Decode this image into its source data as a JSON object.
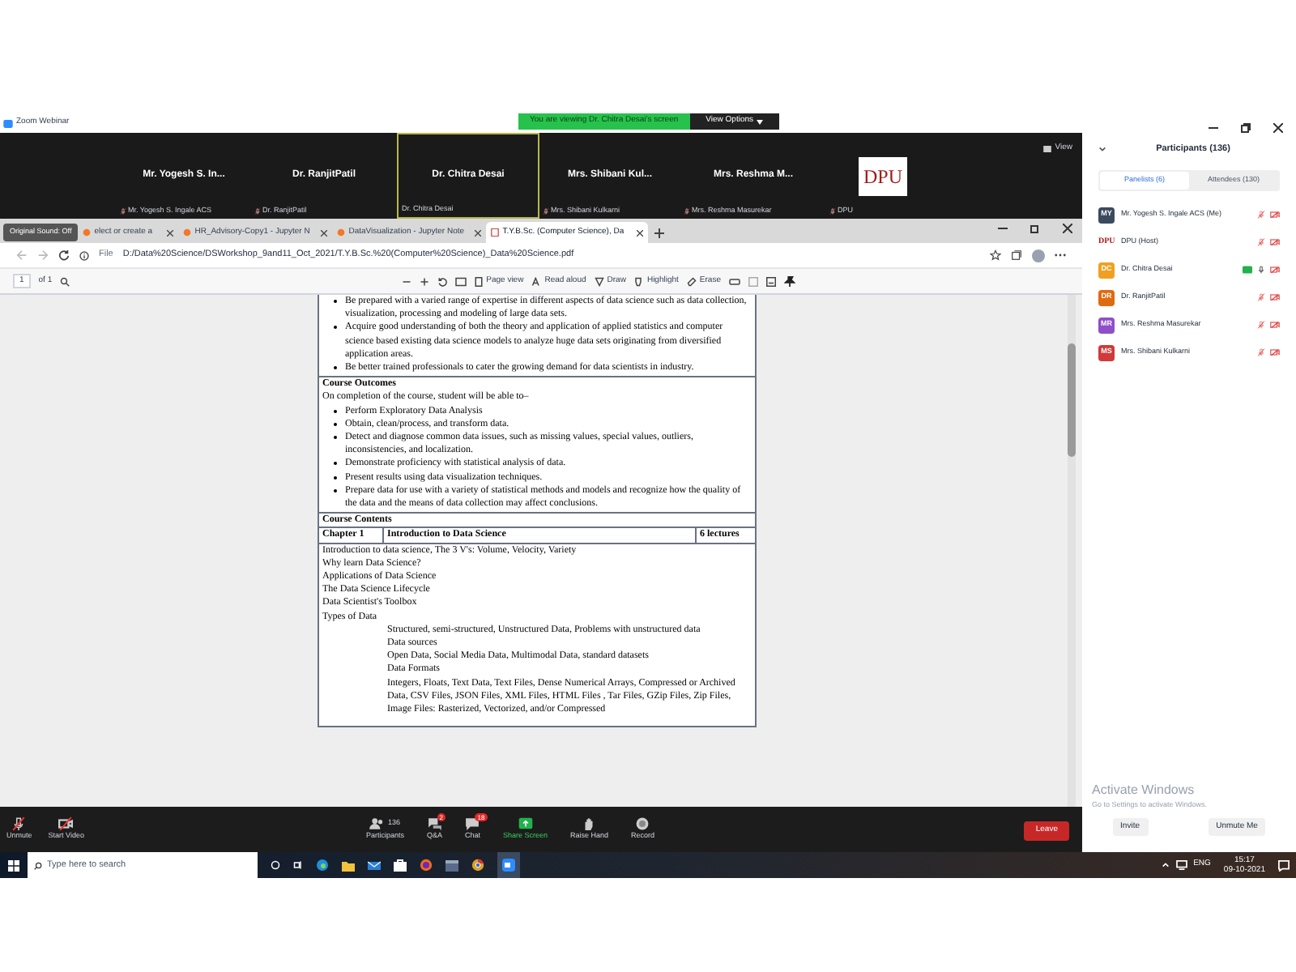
{
  "zoom_window": {
    "title": "Zoom Webinar",
    "viewing_banner": "You are viewing Dr. Chitra Desai's screen",
    "view_options": "View Options",
    "view_button": "View"
  },
  "video_tiles": [
    {
      "kind": "name",
      "display_name": "Mr. Yogesh S. In...",
      "label": "Mr. Yogesh S. Ingale ACS",
      "muted": true,
      "selected": false
    },
    {
      "kind": "name",
      "display_name": "Dr. RanjitPatil",
      "label": "Dr. RanjitPatil",
      "muted": true,
      "selected": false
    },
    {
      "kind": "name",
      "display_name": "Dr. Chitra Desai",
      "label": "Dr. Chitra Desai",
      "muted": false,
      "selected": true
    },
    {
      "kind": "name",
      "display_name": "Mrs. Shibani Kul...",
      "label": "Mrs. Shibani Kulkarni",
      "muted": true,
      "selected": false
    },
    {
      "kind": "name",
      "display_name": "Mrs. Reshma M...",
      "label": "Mrs. Reshma Masurekar",
      "muted": true,
      "selected": false
    },
    {
      "kind": "logo",
      "display_name": "DPU",
      "label": "DPU",
      "muted": true,
      "selected": false
    }
  ],
  "browser": {
    "original_sound_chip": "Original Sound: Off",
    "tabs": [
      {
        "title": "elect or create a",
        "selected": false,
        "kind": "jupyter"
      },
      {
        "title": "HR_Advisory-Copy1 - Jupyter N",
        "selected": false,
        "kind": "jupyter"
      },
      {
        "title": "DataVisualization - Jupyter Note",
        "selected": false,
        "kind": "jupyter"
      },
      {
        "title": "T.Y.B.Sc. (Computer Science), Da",
        "selected": true,
        "kind": "pdf"
      }
    ],
    "address_scheme": "File",
    "address": "D:/Data%20Science/DSWorkshop_9and11_Oct_2021/T.Y.B.Sc.%20(Computer%20Science)_Data%20Science.pdf"
  },
  "pdf_toolbar": {
    "page": "1",
    "page_count": "of 1",
    "page_view": "Page view",
    "read_aloud": "Read aloud",
    "draw": "Draw",
    "highlight": "Highlight",
    "erase": "Erase"
  },
  "document": {
    "objectives": [
      "Be prepared with a varied range of expertise in different aspects of data science such as data collection, visualization, processing and modeling of large data sets.",
      "Acquire good understanding of both the theory and application of applied statistics and computer science based existing data science models to analyze huge data sets originating from diversified application areas.",
      "Be better trained professionals to cater the growing demand for data scientists in industry."
    ],
    "outcomes_heading": "Course Outcomes",
    "outcomes_intro": "On completion of the course, student will be able to–",
    "outcomes": [
      "Perform Exploratory Data Analysis",
      "Obtain, clean/process, and transform data.",
      "Detect and diagnose common data issues, such as missing values, special values, outliers, inconsistencies, and localization.",
      "Demonstrate proficiency with statistical analysis of data.",
      "Present results using data visualization techniques.",
      "Prepare data for use with a variety of statistical methods and models and recognize how the quality of the data and the means of data collection may affect conclusions."
    ],
    "contents_heading": "Course Contents",
    "chapter": "Chapter 1",
    "chapter_title": "Introduction to Data Science",
    "lectures": "6 lectures",
    "topics": [
      {
        "text": "Introduction to data science, The 3 V's: Volume, Velocity, Variety"
      },
      {
        "text": "Why learn Data Science?"
      },
      {
        "text": "Applications of Data Science"
      },
      {
        "text": "The Data Science Lifecycle"
      },
      {
        "text": "Data Scientist's Toolbox"
      },
      {
        "text": "Types of Data",
        "children": [
          {
            "text": "Structured, semi-structured, Unstructured Data, Problems with unstructured data"
          },
          {
            "text": "Data sources"
          },
          {
            "text": "Open Data, Social Media Data, Multimodal Data, standard datasets"
          },
          {
            "text": "Data Formats"
          },
          {
            "text": "Integers, Floats, Text Data, Text Files, Dense Numerical Arrays, Compressed or Archived Data, CSV Files, JSON Files, XML Files, HTML Files , Tar Files, GZip Files, Zip Files, Image Files: Rasterized, Vectorized, and/or Compressed"
          }
        ]
      }
    ]
  },
  "zoom_toolbar": {
    "buttons": [
      {
        "kind": "unmute",
        "label": "Unmute"
      },
      {
        "kind": "video",
        "label": "Start Video"
      },
      {
        "kind": "participants",
        "label": "Participants",
        "count": "136"
      },
      {
        "kind": "qa",
        "label": "Q&A",
        "badge": "2"
      },
      {
        "kind": "chat",
        "label": "Chat",
        "badge": "18"
      },
      {
        "kind": "share",
        "label": "Share Screen"
      },
      {
        "kind": "hand",
        "label": "Raise Hand"
      },
      {
        "kind": "record",
        "label": "Record"
      }
    ],
    "leave": "Leave"
  },
  "participants_panel": {
    "title": "Participants (136)",
    "tabs": [
      {
        "label": "Panelists (6)",
        "selected": true
      },
      {
        "label": "Attendees (130)",
        "selected": false
      }
    ],
    "people": [
      {
        "kind": "avatar",
        "initials": "MY",
        "color": "#3b4a5e",
        "name": "Mr. Yogesh S. Ingale ACS (Me)",
        "muted": true
      },
      {
        "kind": "logo",
        "initials": "DPU",
        "color": "#b01818",
        "name": "DPU (Host)",
        "muted": true
      },
      {
        "kind": "avatar",
        "initials": "DC",
        "color": "#f0a020",
        "name": "Dr. Chitra Desai",
        "muted": false
      },
      {
        "kind": "avatar",
        "initials": "DR",
        "color": "#e06a10",
        "name": "Dr. RanjitPatil",
        "muted": true
      },
      {
        "kind": "avatar",
        "initials": "MR",
        "color": "#8e4fc8",
        "name": "Mrs. Reshma Masurekar",
        "muted": true
      },
      {
        "kind": "avatar",
        "initials": "MS",
        "color": "#d03a3a",
        "name": "Mrs. Shibani Kulkarni",
        "muted": true
      }
    ],
    "invite": "Invite",
    "unmute_me": "Unmute Me"
  },
  "activation_notice": {
    "title": "Activate Windows",
    "message": "Go to Settings to activate Windows."
  },
  "taskbar": {
    "search_placeholder": "Type here to search",
    "language": "ENG",
    "time": "15:17",
    "date": "09-10-2021"
  }
}
